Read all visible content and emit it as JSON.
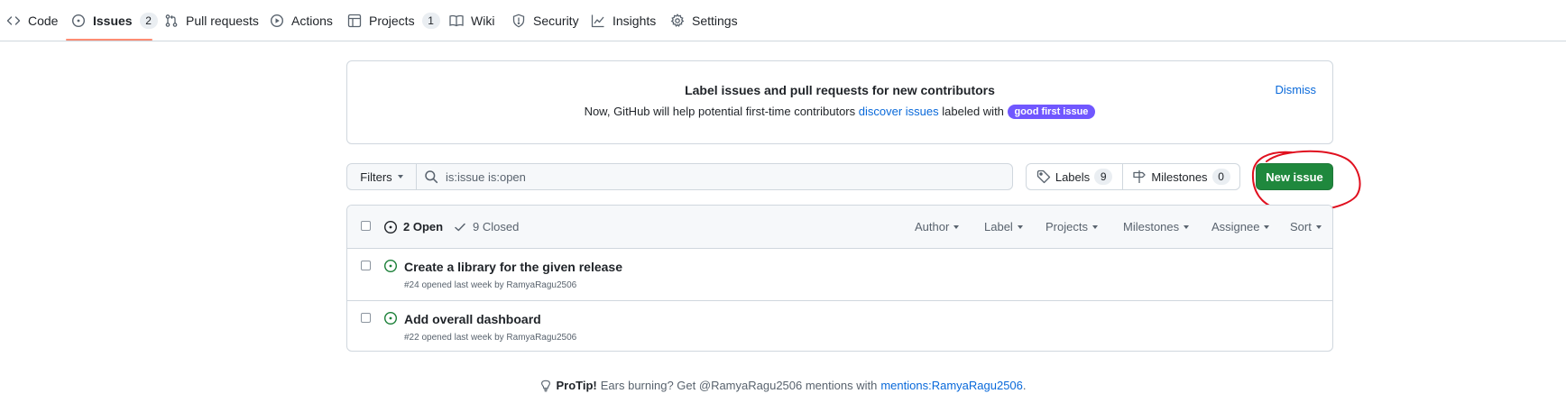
{
  "nav": {
    "items": [
      {
        "label": "Code",
        "icon": "code-icon"
      },
      {
        "label": "Issues",
        "icon": "issue-opened-icon",
        "counter": "2"
      },
      {
        "label": "Pull requests",
        "icon": "git-pull-request-icon"
      },
      {
        "label": "Actions",
        "icon": "play-icon"
      },
      {
        "label": "Projects",
        "icon": "table-icon",
        "counter": "1"
      },
      {
        "label": "Wiki",
        "icon": "book-icon"
      },
      {
        "label": "Security",
        "icon": "shield-icon"
      },
      {
        "label": "Insights",
        "icon": "graph-icon"
      },
      {
        "label": "Settings",
        "icon": "gear-icon"
      }
    ],
    "selected": "Issues"
  },
  "banner": {
    "title": "Label issues and pull requests for new contributors",
    "text_before": "Now, GitHub will help potential first-time contributors",
    "link": "discover issues",
    "text_after": "labeled with",
    "label": "good first issue",
    "label_color": "#7057ff",
    "dismiss": "Dismiss"
  },
  "toolbar": {
    "filters": "Filters",
    "search_value": "is:issue is:open",
    "labels": "Labels",
    "labels_count": "9",
    "milestones": "Milestones",
    "milestones_count": "0",
    "new_issue": "New issue",
    "accent": "#1f883d"
  },
  "list_header": {
    "open": "2 Open",
    "closed": "9 Closed",
    "sorts": [
      "Author",
      "Label",
      "Projects",
      "Milestones",
      "Assignee",
      "Sort"
    ]
  },
  "issues": [
    {
      "title": "Create a library for the given release",
      "meta": "#24 opened last week by RamyaRagu2506"
    },
    {
      "title": "Add overall dashboard",
      "meta": "#22 opened last week by RamyaRagu2506"
    }
  ],
  "protip": {
    "label": "ProTip!",
    "text": "Ears burning? Get @RamyaRagu2506 mentions with",
    "link": "mentions:RamyaRagu2506",
    "end": "."
  },
  "annotation": {
    "color": "#e0101f"
  }
}
